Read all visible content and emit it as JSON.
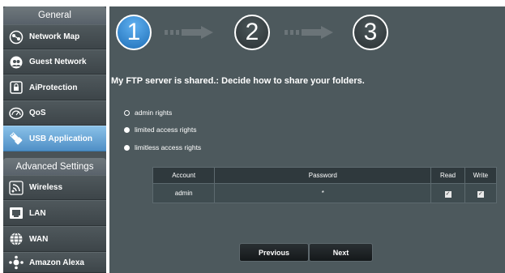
{
  "sidebar": {
    "general_label": "General",
    "advanced_label": "Advanced Settings",
    "general_items": [
      {
        "label": "Network Map",
        "icon": "network-map-icon"
      },
      {
        "label": "Guest Network",
        "icon": "guest-network-icon"
      },
      {
        "label": "AiProtection",
        "icon": "lock-icon"
      },
      {
        "label": "QoS",
        "icon": "speedometer-icon"
      },
      {
        "label": "USB Application",
        "icon": "usb-icon",
        "active": true
      }
    ],
    "advanced_items": [
      {
        "label": "Wireless",
        "icon": "wireless-icon"
      },
      {
        "label": "LAN",
        "icon": "lan-icon"
      },
      {
        "label": "WAN",
        "icon": "globe-icon"
      },
      {
        "label": "Amazon Alexa",
        "icon": "alexa-icon"
      }
    ]
  },
  "wizard": {
    "steps": [
      "1",
      "2",
      "3"
    ],
    "active_step": 1
  },
  "heading": "My FTP server is shared.: Decide how to share your folders.",
  "options": [
    {
      "label": "admin rights",
      "selected": true
    },
    {
      "label": "limited access rights",
      "selected": false
    },
    {
      "label": "limitless access rights",
      "selected": false
    }
  ],
  "table": {
    "headers": [
      "Account",
      "Password",
      "Read",
      "Write"
    ],
    "rows": [
      {
        "account": "admin",
        "password": "*",
        "read": true,
        "write": true
      }
    ]
  },
  "buttons": {
    "previous": "Previous",
    "next": "Next"
  },
  "colors": {
    "panel": "#4d595d",
    "sidebar": "#4a5357",
    "active_item": "#5fa6dc"
  }
}
